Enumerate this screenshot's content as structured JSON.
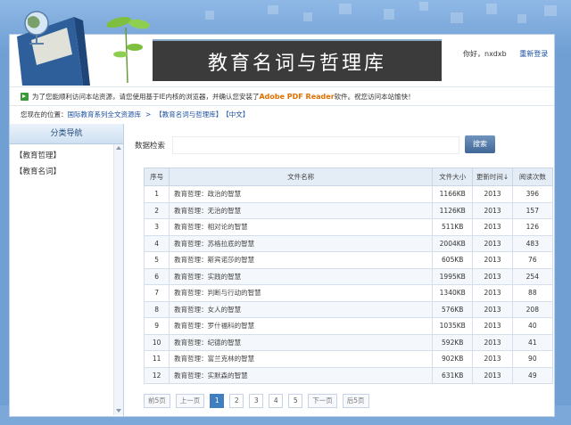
{
  "header": {
    "title": "教育名词与哲理库",
    "user_greeting": "你好，nxdxb",
    "relogin": "重新登录"
  },
  "notice": {
    "text_before": "为了您能顺利访问本站资源，请您使用基于IE内核的浏览器，并确认您安装了",
    "pdf_reader": "Adobe PDF Reader",
    "text_after": "软件。祝您访问本站愉快！"
  },
  "breadcrumb": {
    "label": "您现在的位置：",
    "link1": "国际教育系列全文资源库",
    "separator": ">",
    "link2": "【教育名词与哲理库】",
    "link3": "【中文】"
  },
  "sidebar": {
    "title": "分类导航",
    "items": [
      "【教育哲理】",
      "【教育名词】"
    ]
  },
  "search": {
    "label": "数据检索",
    "value": "",
    "button": "搜索"
  },
  "table": {
    "headers": [
      "序号",
      "文件名称",
      "文件大小",
      "更新时间↓",
      "阅读次数"
    ],
    "rows": [
      [
        "1",
        "教育哲理：政治的智慧",
        "1166KB",
        "2013",
        "396"
      ],
      [
        "2",
        "教育哲理：无治的智慧",
        "1126KB",
        "2013",
        "157"
      ],
      [
        "3",
        "教育哲理：相对论的智慧",
        "511KB",
        "2013",
        "126"
      ],
      [
        "4",
        "教育哲理：苏格拉底的智慧",
        "2004KB",
        "2013",
        "483"
      ],
      [
        "5",
        "教育哲理：斯宾诺莎的智慧",
        "605KB",
        "2013",
        "76"
      ],
      [
        "6",
        "教育哲理：实践的智慧",
        "1995KB",
        "2013",
        "254"
      ],
      [
        "7",
        "教育哲理：判断与行动的智慧",
        "1340KB",
        "2013",
        "88"
      ],
      [
        "8",
        "教育哲理：女人的智慧",
        "576KB",
        "2013",
        "208"
      ],
      [
        "9",
        "教育哲理：罗什福科的智慧",
        "1035KB",
        "2013",
        "40"
      ],
      [
        "10",
        "教育哲理：纪德的智慧",
        "592KB",
        "2013",
        "41"
      ],
      [
        "11",
        "教育哲理：富兰克林的智慧",
        "902KB",
        "2013",
        "90"
      ],
      [
        "12",
        "教育哲理：实默森的智慧",
        "631KB",
        "2013",
        "49"
      ]
    ]
  },
  "pager": {
    "prev5": "前5页",
    "prev": "上一页",
    "pages": [
      "1",
      "2",
      "3",
      "4",
      "5"
    ],
    "current_page": "1",
    "next": "下一页",
    "next5": "后5页"
  },
  "colors": {
    "accent": "#3f7fc0",
    "link": "#1a4fa0",
    "pdf_highlight": "#e07000",
    "banner_bg": "#3b3b3b"
  }
}
